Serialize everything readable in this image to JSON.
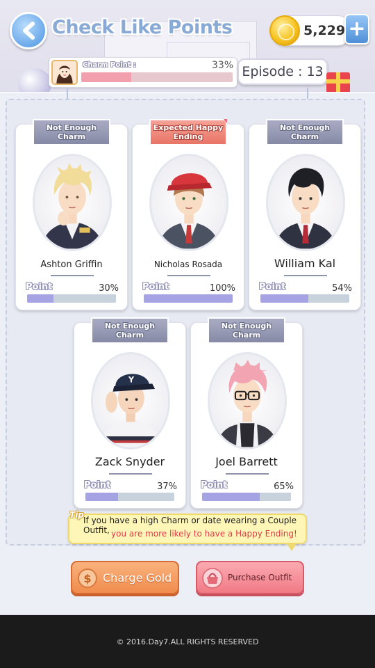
{
  "header": {
    "title": "Check Like Points",
    "gold": "5,229",
    "plus_label": "+"
  },
  "charm": {
    "label": "Charm Point :",
    "percent_text": "33%",
    "percent": 33
  },
  "episode": "Episode : 13",
  "characters": [
    {
      "name": "Ashton Griffin",
      "status": "Not Enough Charm",
      "point_label": "Point",
      "point_text": "30%",
      "point": 30
    },
    {
      "name": "Nicholas Rosada",
      "status": "Expected Happy Ending",
      "point_label": "Point",
      "point_text": "100%",
      "point": 100
    },
    {
      "name": "William Kal",
      "status": "Not Enough Charm",
      "point_label": "Point",
      "point_text": "54%",
      "point": 54
    },
    {
      "name": "Zack Snyder",
      "status": "Not Enough Charm",
      "point_label": "Point",
      "point_text": "37%",
      "point": 37
    },
    {
      "name": "Joel Barrett",
      "status": "Not Enough Charm",
      "point_label": "Point",
      "point_text": "65%",
      "point": 65
    }
  ],
  "tip": {
    "tag": "Tip",
    "line1": "If you have a high Charm or date wearing a Couple Outfit,",
    "line2": "you are more likely to have a Happy Ending!"
  },
  "buttons": {
    "charge_gold": "Charge Gold",
    "charge_icon": "$",
    "purchase_outfit": "Purchase Outfit"
  },
  "footer": {
    "copyright": "© 2016.Day7.ALL RIGHTS RESERVED"
  },
  "colors": {
    "accent_blue": "#6aa9ea",
    "point_fill": "#a6a3e4",
    "charm_fill": "#f2a0ae",
    "happy_ribbon": "#e77567",
    "tip_red": "#e2394b"
  }
}
